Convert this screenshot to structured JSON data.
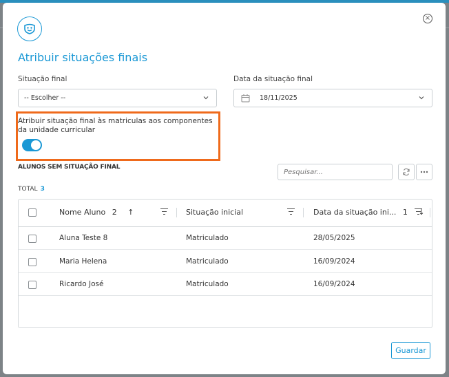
{
  "modal": {
    "title": "Atribuir situações finais",
    "close_symbol": "×"
  },
  "form": {
    "situacao_final": {
      "label": "Situação final",
      "value": "-- Escolher --"
    },
    "data_situacao_final": {
      "label": "Data da situação final",
      "value": "18/11/2025"
    },
    "toggle": {
      "label": "Atribuir situação final às matriculas aos componentes da unidade curricular",
      "on": true
    }
  },
  "list": {
    "section_title": "ALUNOS SEM SITUAÇÃO FINAL",
    "search_placeholder": "Pesquisar...",
    "total_label": "TOTAL",
    "total_value": "3",
    "columns": [
      {
        "label": "Nome Aluno",
        "sort_index": "2",
        "sort_dir": "↑"
      },
      {
        "label": "Situação inicial",
        "sort_index": "",
        "sort_dir": ""
      },
      {
        "label": "Data da situação ini...",
        "sort_index": "1",
        "sort_dir": "↓"
      }
    ],
    "rows": [
      {
        "nome": "Aluna Teste 8",
        "situacao": "Matriculado",
        "data": "28/05/2025"
      },
      {
        "nome": "Maria Helena",
        "situacao": "Matriculado",
        "data": "16/09/2024"
      },
      {
        "nome": "Ricardo José",
        "situacao": "Matriculado",
        "data": "16/09/2024"
      }
    ]
  },
  "actions": {
    "save_label": "Guardar"
  },
  "colors": {
    "accent": "#1a98d5",
    "highlight": "#ef6a1b",
    "backdrop": "#7d8387"
  }
}
